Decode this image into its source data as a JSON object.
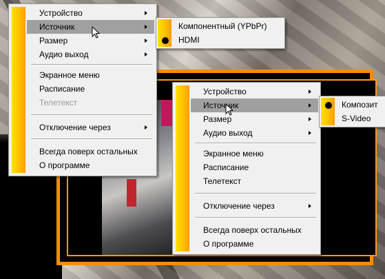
{
  "menu_main": {
    "device": "Устройство",
    "source": "Источник",
    "size": "Размер",
    "audio_out": "Аудио выход",
    "osd": "Экранное меню",
    "schedule": "Расписание",
    "teletext": "Телетекст",
    "shutdown": "Отключение через",
    "always_on_top": "Всегда поверх остальных",
    "about": "О программе"
  },
  "submenu_main": {
    "component": "Компонентный (YPbPr)",
    "hdmi": "HDMI",
    "selected": "hdmi"
  },
  "menu_second": {
    "device": "Устройство",
    "source": "Источник",
    "size": "Размер",
    "audio_out": "Аудио выход",
    "osd": "Экранное меню",
    "schedule": "Расписание",
    "teletext": "Телетекст",
    "shutdown": "Отключение через",
    "always_on_top": "Всегда поверх остальных",
    "about": "О программе"
  },
  "submenu_second": {
    "composite": "Композит",
    "svideo": "S-Video",
    "selected": "composite"
  },
  "colors": {
    "window_border": "#ff8c00",
    "strip_top": "#ffe000",
    "strip_bottom": "#ff9c00",
    "highlight": "#a0a0a0"
  }
}
